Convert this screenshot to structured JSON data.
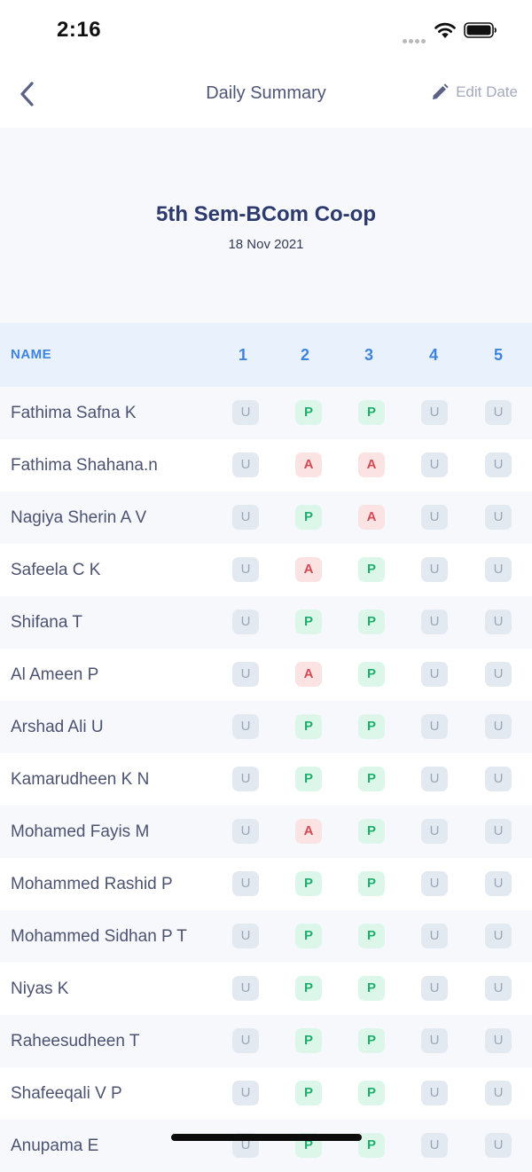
{
  "status_bar": {
    "time": "2:16"
  },
  "nav": {
    "title": "Daily Summary",
    "edit_label": "Edit Date"
  },
  "summary": {
    "class_name": "5th Sem-BCom Co-op",
    "date": "18 Nov 2021"
  },
  "table": {
    "name_header": "NAME",
    "periods": [
      "1",
      "2",
      "3",
      "4",
      "5"
    ],
    "rows": [
      {
        "name": "Fathima Safna K",
        "marks": [
          "U",
          "P",
          "P",
          "U",
          "U"
        ]
      },
      {
        "name": "Fathima Shahana.n",
        "marks": [
          "U",
          "A",
          "A",
          "U",
          "U"
        ]
      },
      {
        "name": "Nagiya Sherin A V",
        "marks": [
          "U",
          "P",
          "A",
          "U",
          "U"
        ]
      },
      {
        "name": "Safeela C K",
        "marks": [
          "U",
          "A",
          "P",
          "U",
          "U"
        ]
      },
      {
        "name": "Shifana T",
        "marks": [
          "U",
          "P",
          "P",
          "U",
          "U"
        ]
      },
      {
        "name": "Al Ameen P",
        "marks": [
          "U",
          "A",
          "P",
          "U",
          "U"
        ]
      },
      {
        "name": "Arshad Ali U",
        "marks": [
          "U",
          "P",
          "P",
          "U",
          "U"
        ]
      },
      {
        "name": "Kamarudheen K N",
        "marks": [
          "U",
          "P",
          "P",
          "U",
          "U"
        ]
      },
      {
        "name": "Mohamed Fayis M",
        "marks": [
          "U",
          "A",
          "P",
          "U",
          "U"
        ]
      },
      {
        "name": "Mohammed Rashid P",
        "marks": [
          "U",
          "P",
          "P",
          "U",
          "U"
        ]
      },
      {
        "name": "Mohammed Sidhan P T",
        "marks": [
          "U",
          "P",
          "P",
          "U",
          "U"
        ]
      },
      {
        "name": "Niyas K",
        "marks": [
          "U",
          "P",
          "P",
          "U",
          "U"
        ]
      },
      {
        "name": "Raheesudheen T",
        "marks": [
          "U",
          "P",
          "P",
          "U",
          "U"
        ]
      },
      {
        "name": "Shafeeqali V P",
        "marks": [
          "U",
          "P",
          "P",
          "U",
          "U"
        ]
      },
      {
        "name": "Anupama E",
        "marks": [
          "U",
          "P",
          "P",
          "U",
          "U"
        ]
      }
    ]
  },
  "colors": {
    "accent": "#3d84e0",
    "present": "#1fae6d",
    "absent": "#d34a55",
    "unmarked": "#9aa7b8"
  },
  "icons": [
    "back-icon",
    "pencil-icon",
    "wifi-icon",
    "battery-icon",
    "signal-icon"
  ]
}
